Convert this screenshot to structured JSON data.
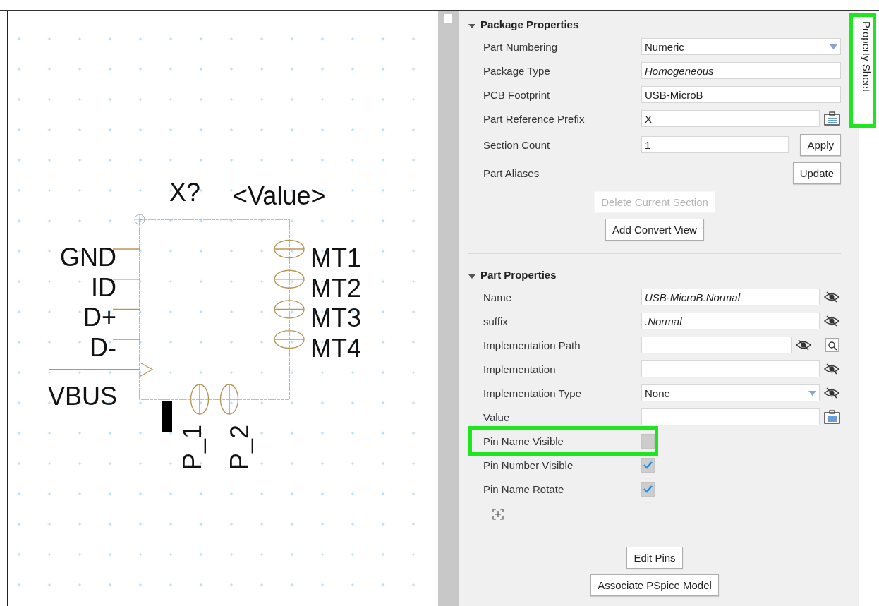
{
  "canvas": {
    "reference": "X?",
    "value": "<Value>",
    "left_pins": [
      {
        "name": "GND",
        "kind": "line"
      },
      {
        "name": "ID",
        "kind": "line"
      },
      {
        "name": "D+",
        "kind": "line"
      },
      {
        "name": "D-",
        "kind": "line"
      },
      {
        "name": "VBUS",
        "kind": "clock"
      }
    ],
    "right_pins": [
      "MT1",
      "MT2",
      "MT3",
      "MT4"
    ],
    "bottom_pins": [
      "P_1",
      "P_2"
    ]
  },
  "side_tab": {
    "label": "Property Sheet",
    "highlighted": true
  },
  "sections": [
    {
      "title": "Package Properties",
      "expanded": true,
      "rows": [
        {
          "kind": "dropdown",
          "label": "Part Numbering",
          "value": "Numeric",
          "icons": []
        },
        {
          "kind": "text",
          "label": "Package Type",
          "value": "Homogeneous",
          "italic": true,
          "icons": []
        },
        {
          "kind": "text",
          "label": "PCB Footprint",
          "value": "USB-MicroB",
          "italic": false,
          "icons": []
        },
        {
          "kind": "text",
          "label": "Part Reference Prefix",
          "value": "X",
          "italic": false,
          "icons": [
            {
              "kind": "clipboard"
            }
          ]
        },
        {
          "kind": "text_button",
          "label": "Section Count",
          "value": "1",
          "italic": false,
          "button": "Apply"
        },
        {
          "kind": "button",
          "label": "Part Aliases",
          "button": "Update"
        }
      ],
      "buttons": [
        {
          "label": "Delete Current Section",
          "disabled": true
        },
        {
          "label": "Add Convert View",
          "disabled": false
        }
      ]
    },
    {
      "title": "Part Properties",
      "expanded": true,
      "rows": [
        {
          "kind": "text",
          "label": "Name",
          "value": "USB-MicroB.Normal",
          "italic": true,
          "icons": [
            {
              "kind": "eye"
            }
          ]
        },
        {
          "kind": "text",
          "label": "suffix",
          "value": ".Normal",
          "italic": true,
          "icons": [
            {
              "kind": "eye"
            }
          ]
        },
        {
          "kind": "text",
          "label": "Implementation Path",
          "italic": false,
          "icons": [
            {
              "kind": "eye"
            },
            {
              "kind": "browse"
            }
          ]
        },
        {
          "kind": "text",
          "label": "Implementation",
          "italic": false,
          "icons": [
            {
              "kind": "eye"
            }
          ]
        },
        {
          "kind": "dropdown",
          "label": "Implementation Type",
          "value": "None",
          "icons": [
            {
              "kind": "eye"
            }
          ]
        },
        {
          "kind": "text",
          "label": "Value",
          "italic": false,
          "icons": [
            {
              "kind": "clipboard"
            }
          ]
        },
        {
          "kind": "checkbox",
          "label": "Pin Name Visible",
          "checked": false,
          "highlighted": true
        },
        {
          "kind": "checkbox",
          "label": "Pin Number Visible",
          "checked": true,
          "highlighted": false
        },
        {
          "kind": "checkbox",
          "label": "Pin Name Rotate",
          "checked": true,
          "highlighted": false
        },
        {
          "kind": "add_property"
        }
      ],
      "buttons": [
        {
          "label": "Edit Pins",
          "disabled": false
        },
        {
          "label": "Associate PSpice Model",
          "disabled": false
        }
      ]
    }
  ]
}
